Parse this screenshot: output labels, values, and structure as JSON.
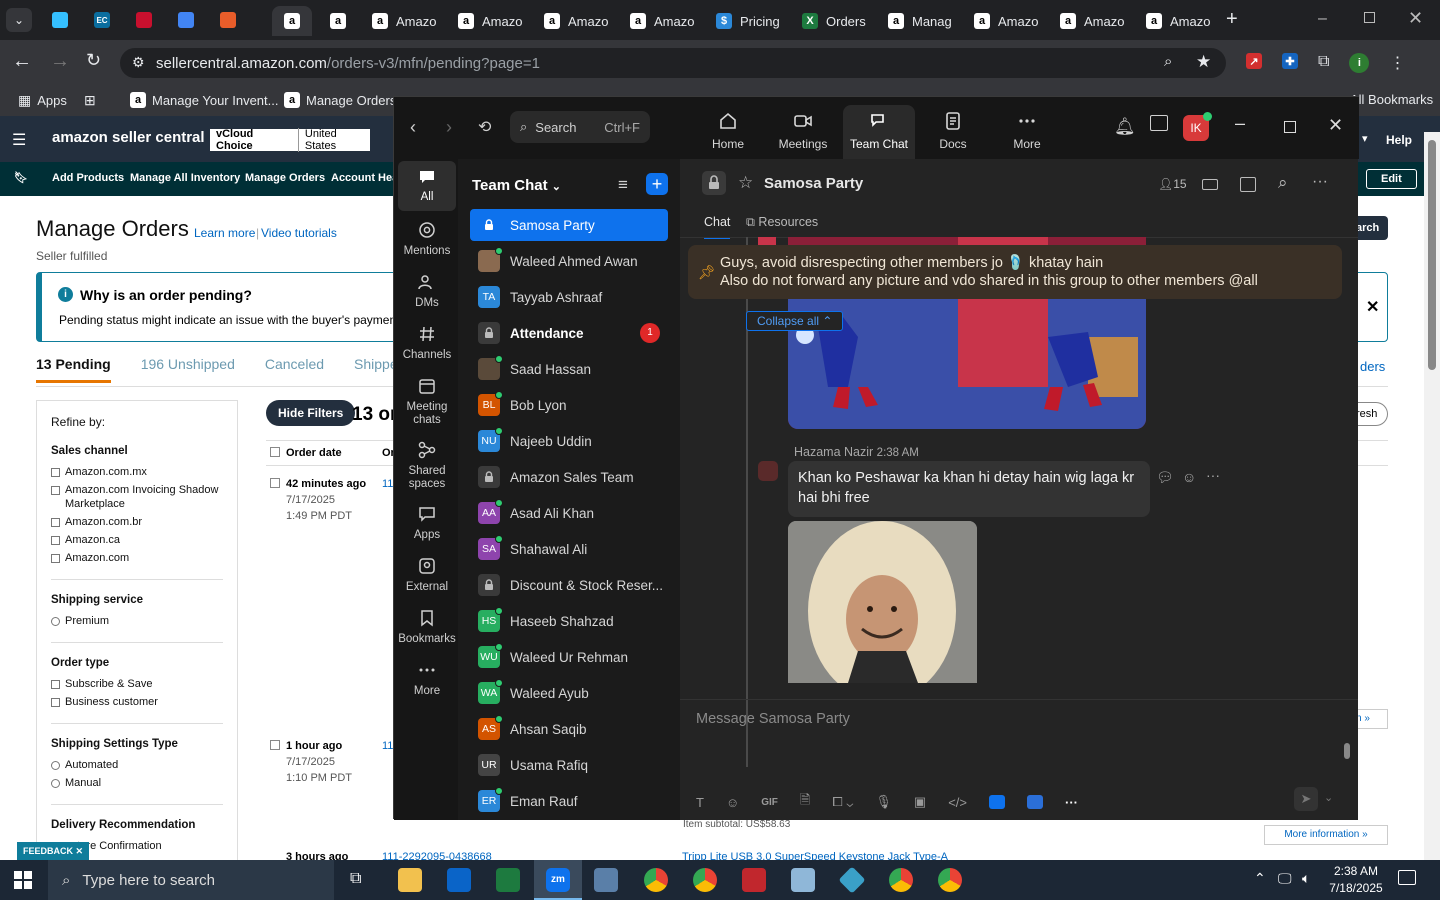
{
  "browser": {
    "tabs": [
      "Amazo",
      "Amazo",
      "Amazo",
      "Amazo",
      "Pricing",
      "Orders",
      "Manag",
      "Amazo",
      "Amazo",
      "Amazo"
    ],
    "url_host": "sellercentral.amazon.com",
    "url_path": "/orders-v3/mfn/pending?page=1",
    "bookmarks": [
      "Apps",
      "Manage Your Invent...",
      "Manage Orders"
    ],
    "all_bookmarks": "All Bookmarks"
  },
  "amazon": {
    "logo": "amazon seller central",
    "vcloud": "vCloud Choice",
    "region": "United States",
    "help": "Help",
    "nav": [
      "Add Products",
      "Manage All Inventory",
      "Manage Orders",
      "Account Heal"
    ],
    "edit": "Edit",
    "page_title": "Manage Orders",
    "learn_more": "Learn more",
    "video_tutorials": "Video tutorials",
    "subtitle": "Seller fulfilled",
    "info_title": "Why is an order pending?",
    "info_text": "Pending status might indicate an issue with the buyer's payment m",
    "tabs": [
      "13 Pending",
      "196 Unshipped",
      "Canceled",
      "Shippe"
    ],
    "hide_filters": "Hide Filters",
    "count": "13 or",
    "refine": "Refine by:",
    "filters": [
      {
        "title": "Sales channel",
        "items": [
          "Amazon.com.mx",
          "Amazon.com Invoicing Shadow Marketplace",
          "Amazon.com.br",
          "Amazon.ca",
          "Amazon.com"
        ]
      },
      {
        "title": "Shipping service",
        "items": [
          "Premium"
        ]
      },
      {
        "title": "Order type",
        "items": [
          "Subscribe & Save",
          "Business customer"
        ]
      },
      {
        "title": "Shipping Settings Type",
        "items": [
          "Automated",
          "Manual"
        ]
      },
      {
        "title": "Delivery Recommendation",
        "items": [
          "nature Confirmation"
        ]
      }
    ],
    "col_date": "Order date",
    "col_or": "Or",
    "orders": [
      {
        "age": "42 minutes ago",
        "date": "7/17/2025",
        "time": "1:49 PM PDT",
        "id": "11"
      },
      {
        "age": "1 hour ago",
        "date": "7/17/2025",
        "time": "1:10 PM PDT",
        "id": "11"
      },
      {
        "age": "3 hours ago",
        "date": "",
        "time": "",
        "id": "111-2292095-0438668"
      }
    ],
    "item_subtotal": "Item subtotal: US$58.63",
    "more_info": "More information »",
    "feedback": "FEEDBACK",
    "right_bits": {
      "search": "arch",
      "ders": "ders",
      "fresh": "resh",
      "on": "n »",
      "product": "Tripp Lite USB 3.0 SuperSpeed Keystone Jack Type-A"
    }
  },
  "zoom": {
    "search_label": "Search",
    "search_shortcut": "Ctrl+F",
    "top_nav": [
      "Home",
      "Meetings",
      "Team Chat",
      "Docs",
      "More"
    ],
    "user_initials": "IK",
    "sidebar": [
      "All",
      "Mentions",
      "DMs",
      "Channels",
      "Meeting chats",
      "Shared spaces",
      "Apps",
      "External",
      "Bookmarks",
      "More"
    ],
    "list_title": "Team Chat",
    "chats": [
      {
        "name": "Samosa Party",
        "type": "lock",
        "bold": false
      },
      {
        "name": "Waleed Ahmed Awan",
        "type": "photo",
        "color": "#8a6a50"
      },
      {
        "name": "Tayyab Ashraaf",
        "type": "initials",
        "initials": "TA",
        "color": "#2b88d8",
        "dot": false
      },
      {
        "name": "Attendance",
        "type": "lock",
        "bold": true,
        "badge": "1"
      },
      {
        "name": "Saad Hassan",
        "type": "photo",
        "color": "#5a4a3a"
      },
      {
        "name": "Bob Lyon",
        "type": "initials",
        "initials": "BL",
        "color": "#d35400",
        "dot": true
      },
      {
        "name": "Najeeb Uddin",
        "type": "initials",
        "initials": "NU",
        "color": "#2b88d8",
        "dot": true
      },
      {
        "name": "Amazon Sales Team",
        "type": "lock"
      },
      {
        "name": "Asad Ali Khan",
        "type": "initials",
        "initials": "AA",
        "color": "#8e44ad",
        "dot": true
      },
      {
        "name": "Shahawal Ali",
        "type": "initials",
        "initials": "SA",
        "color": "#8e44ad",
        "dot": true
      },
      {
        "name": "Discount & Stock Reser...",
        "type": "lock"
      },
      {
        "name": "Haseeb Shahzad",
        "type": "initials",
        "initials": "HS",
        "color": "#27ae60",
        "dot": true
      },
      {
        "name": "Waleed Ur Rehman",
        "type": "initials",
        "initials": "WU",
        "color": "#27ae60",
        "dot": true
      },
      {
        "name": "Waleed Ayub",
        "type": "initials",
        "initials": "WA",
        "color": "#27ae60",
        "dot": true
      },
      {
        "name": "Ahsan Saqib",
        "type": "initials",
        "initials": "AS",
        "color": "#d35400",
        "dot": true
      },
      {
        "name": "Usama Rafiq",
        "type": "initials",
        "initials": "UR",
        "color": "#444",
        "dot": false
      },
      {
        "name": "Eman Rauf",
        "type": "initials",
        "initials": "ER",
        "color": "#2b88d8",
        "dot": true
      }
    ],
    "channel_name": "Samosa Party",
    "member_count": "15",
    "chat_tabs": [
      "Chat",
      "Resources"
    ],
    "pinned_line1": "Guys, avoid disrespecting other members jo 🩴 khatay hain",
    "pinned_line2": "Also do not forward any picture and vdo shared in this group to other members @all",
    "collapse_all": "Collapse all",
    "sender": "Hazama Nazir",
    "sent_time": "2:38 AM",
    "message": "Khan ko Peshawar ka khan hi detay hain wig laga kr hai bhi free",
    "compose_placeholder": "Message Samosa Party"
  },
  "taskbar": {
    "search": "Type here to search",
    "time": "2:38 AM",
    "date": "7/18/2025"
  }
}
